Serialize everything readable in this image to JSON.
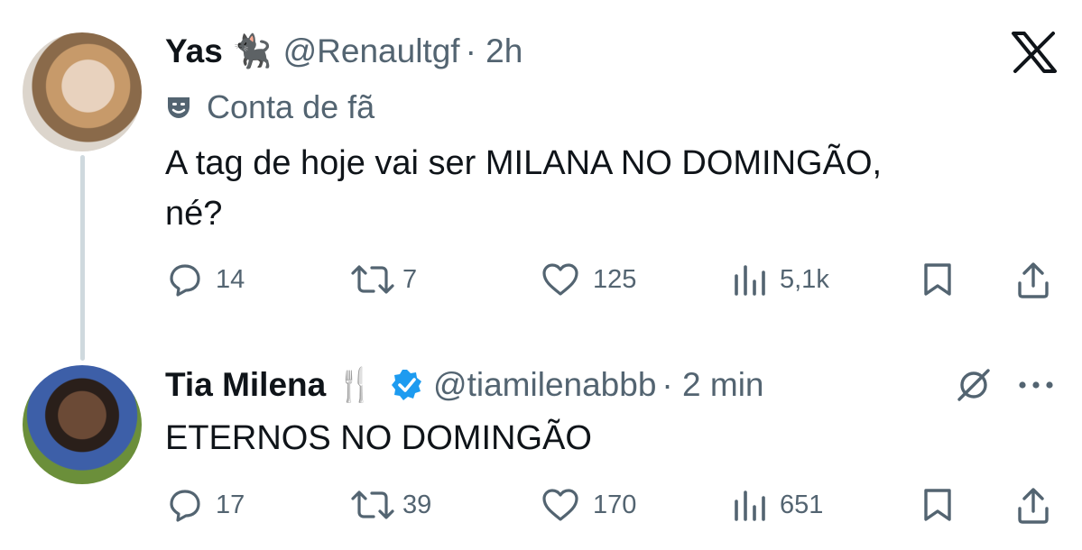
{
  "tweets": [
    {
      "name": "Yas",
      "emoji": "🐈‍⬛",
      "handle": "@Renaultgf",
      "time": "· 2h",
      "label": "Conta de fã",
      "text_line1": "A tag de hoje vai ser MILANA NO DOMINGÃO,",
      "text_line2": "né?",
      "replies": "14",
      "reposts": "7",
      "likes": "125",
      "views": "5,1k"
    },
    {
      "name": "Tia Milena",
      "emoji": "🍴",
      "verified": true,
      "handle": "@tiamilenabbb",
      "time": "· 2 min",
      "text": "ETERNOS NO DOMINGÃO",
      "replies": "17",
      "reposts": "39",
      "likes": "170",
      "views": "651"
    }
  ],
  "colors": {
    "secondary_text": "#536471",
    "verified_blue": "#1d9bf0",
    "thread_line": "#cfd9de"
  },
  "icons": [
    "x-logo-icon",
    "theater-masks-icon",
    "reply-icon",
    "repost-icon",
    "like-icon",
    "views-icon",
    "bookmark-icon",
    "share-icon",
    "grok-icon",
    "more-icon",
    "verified-badge-icon"
  ]
}
